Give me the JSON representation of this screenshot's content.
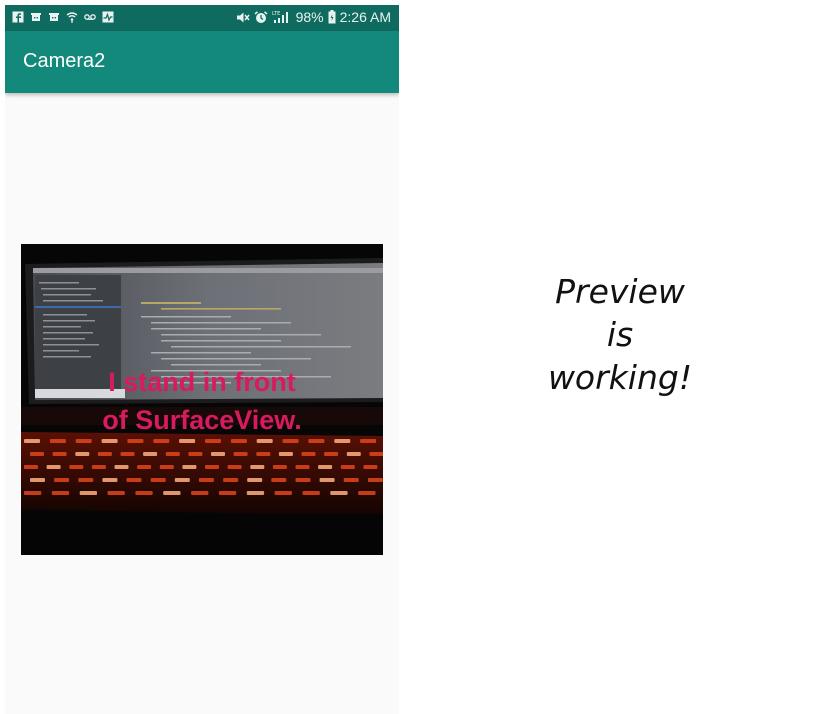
{
  "status_bar": {
    "battery": "98%",
    "time": "2:26 AM",
    "left_icons": [
      "facebook-icon",
      "android-debug-icon",
      "android-debug-icon",
      "wifi-icon",
      "voicemail-icon",
      "pulse-icon"
    ],
    "right_icons": [
      "mute-icon",
      "alarm-icon",
      "lte-signal-icon",
      "battery-icon"
    ]
  },
  "app_bar": {
    "title": "Camera2",
    "color": "#12897a",
    "status_color": "#0f6b5f"
  },
  "preview": {
    "overlay_line1": "I stand in front",
    "overlay_line2": "of SurfaceView.",
    "overlay_color": "#d81b60"
  },
  "side_text": {
    "line1": "Preview",
    "line2": "is",
    "line3": "working!"
  }
}
